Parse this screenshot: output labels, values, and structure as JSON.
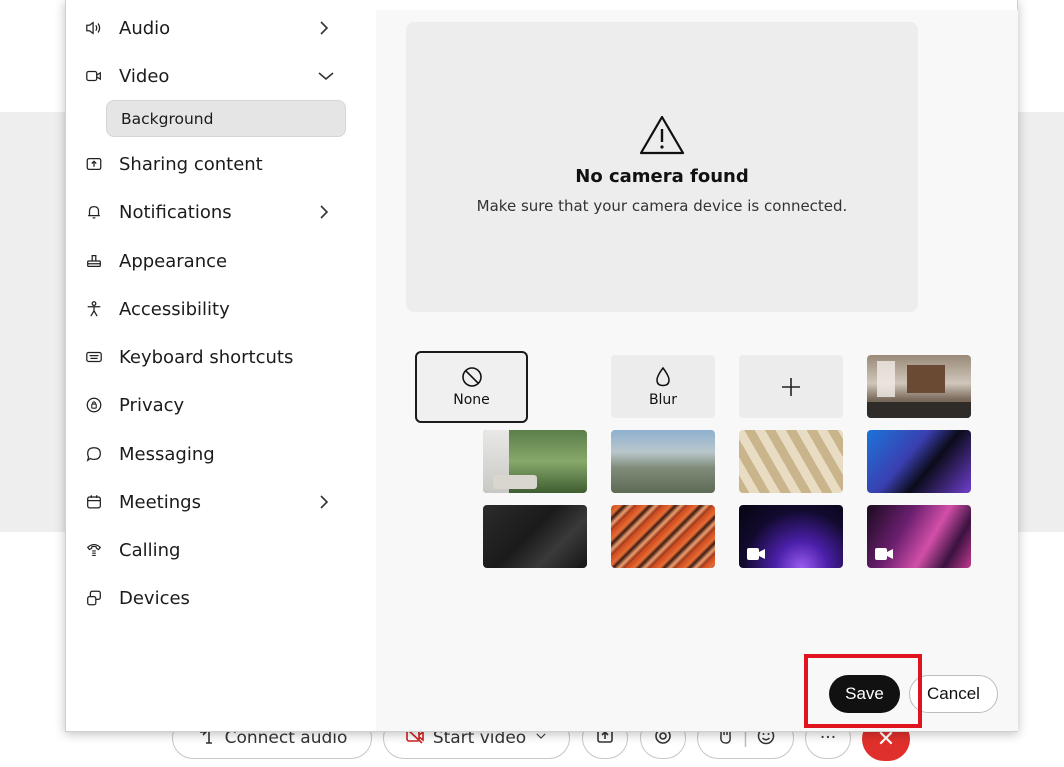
{
  "sidebar": {
    "items": [
      {
        "label": "Audio",
        "icon": "speaker-icon",
        "chevron": "right"
      },
      {
        "label": "Video",
        "icon": "video-camera-icon",
        "chevron": "down"
      },
      {
        "label": "Sharing content",
        "icon": "share-screen-icon"
      },
      {
        "label": "Notifications",
        "icon": "bell-icon",
        "chevron": "right"
      },
      {
        "label": "Appearance",
        "icon": "paint-brush-icon"
      },
      {
        "label": "Accessibility",
        "icon": "accessibility-icon"
      },
      {
        "label": "Keyboard shortcuts",
        "icon": "keyboard-icon"
      },
      {
        "label": "Privacy",
        "icon": "privacy-icon"
      },
      {
        "label": "Messaging",
        "icon": "chat-bubble-icon"
      },
      {
        "label": "Meetings",
        "icon": "calendar-icon",
        "chevron": "right"
      },
      {
        "label": "Calling",
        "icon": "phone-icon"
      },
      {
        "label": "Devices",
        "icon": "devices-icon"
      }
    ],
    "sub_item": {
      "label": "Background",
      "selected": true
    }
  },
  "preview": {
    "icon": "warning-icon",
    "title": "No camera found",
    "message": "Make sure that your camera device is connected."
  },
  "backgrounds": {
    "options": [
      {
        "label": "None",
        "icon": "no-symbol-icon",
        "selected": true
      },
      {
        "label": "Blur",
        "icon": "droplet-icon"
      },
      {
        "label": "",
        "icon": "plus-icon"
      }
    ],
    "images": [
      "living-room",
      "forest-room",
      "blurred-mountains",
      "window-shadows",
      "blue-purple-waves",
      "dark-abstract",
      "orange-marble",
      "purple-glow-video",
      "pink-waves-video"
    ]
  },
  "footer": {
    "save": "Save",
    "cancel": "Cancel"
  },
  "meeting_toolbar": {
    "connect_audio": "Connect audio",
    "start_video": "Start video",
    "more": "···",
    "end": "✕"
  },
  "colors": {
    "accent_dark": "#111111",
    "highlight": "#e0141e",
    "end_call": "#e0302b"
  }
}
